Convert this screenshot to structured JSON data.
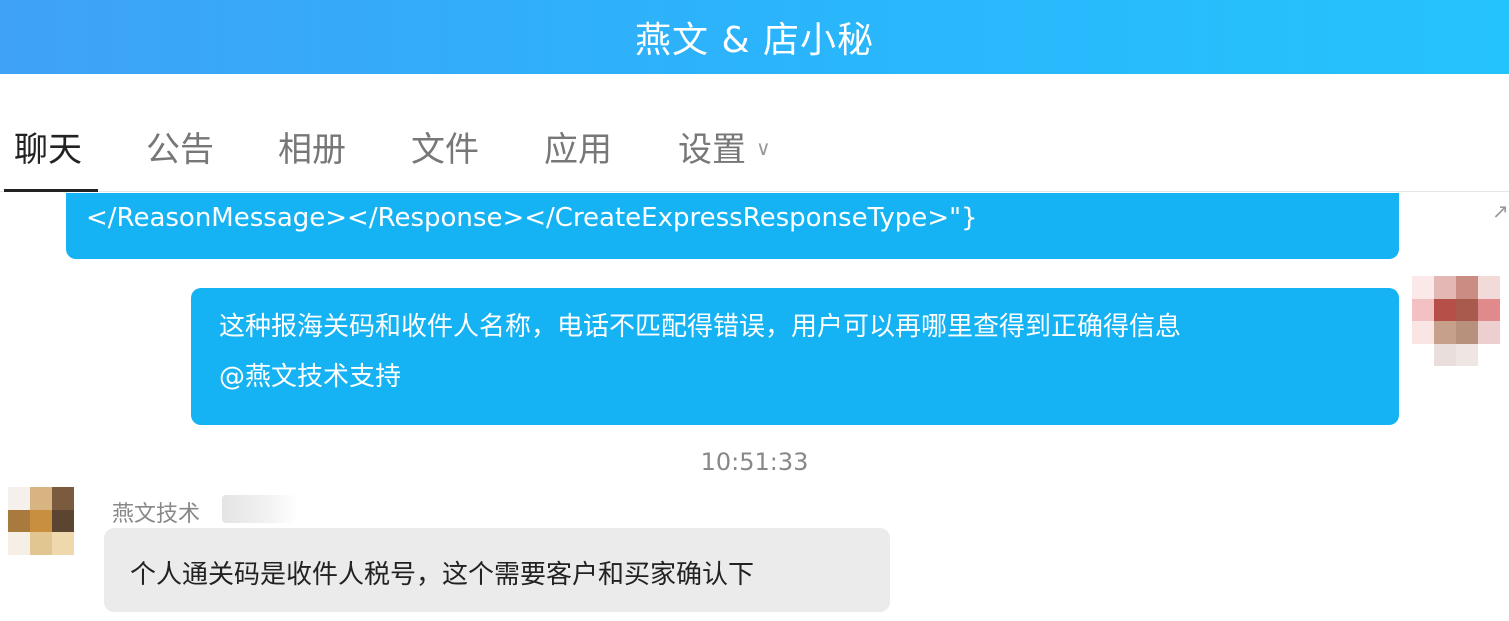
{
  "window": {
    "title": "燕文 & 店小秘"
  },
  "tabs": [
    {
      "label": "聊天"
    },
    {
      "label": "公告"
    },
    {
      "label": "相册"
    },
    {
      "label": "文件"
    },
    {
      "label": "应用"
    },
    {
      "label": "设置"
    }
  ],
  "messages": {
    "truncated_top": {
      "text": "</ReasonMessage></Response></CreateExpressResponseType>\"}"
    },
    "mine": {
      "line1": "这种报海关码和收件人名称，电话不匹配得错误，用户可以再哪里查得到正确得信息",
      "line2": "@燕文技术支持"
    },
    "timestamp": "10:51:33",
    "reply": {
      "sender": "燕文技术",
      "text": "个人通关码是收件人税号，这个需要客户和买家确认下"
    }
  },
  "colors": {
    "accent": "#15b3f3",
    "title_gradient_start": "#3fa2f5",
    "title_gradient_end": "#25c3fd",
    "received_bubble": "#ebebeb"
  },
  "icons": {
    "settings_dropdown": "chevron-down-icon",
    "scroll": "scroll-arrow-icon"
  }
}
